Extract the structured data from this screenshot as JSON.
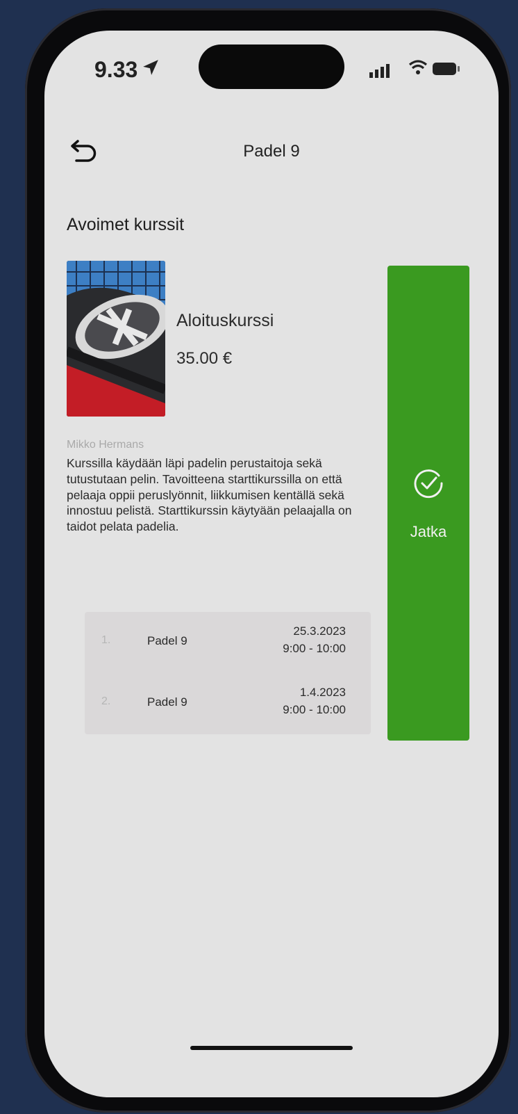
{
  "status_bar": {
    "time": "9.33"
  },
  "nav": {
    "title": "Padel 9"
  },
  "section": {
    "title": "Avoimet kurssit"
  },
  "course": {
    "name": "Aloituskurssi",
    "price": "35.00 €",
    "instructor": "Mikko Hermans",
    "description": "Kurssilla käydään läpi padelin perustaitoja sekä tutustutaan pelin. Tavoitteena starttikurssilla on että pelaaja oppii peruslyönnit, liikkumisen kentällä sekä innostuu pelistä. Starttikurssin käytyään pelaajalla on taidot pelata padelia."
  },
  "sessions": [
    {
      "num": "1.",
      "place": "Padel 9",
      "date": "25.3.2023",
      "time": "9:00 - 10:00"
    },
    {
      "num": "2.",
      "place": "Padel 9",
      "date": "1.4.2023",
      "time": "9:00 - 10:00"
    }
  ],
  "action": {
    "label": "Jatka"
  },
  "colors": {
    "accent": "#3a9a20",
    "background": "#e3e3e3"
  }
}
